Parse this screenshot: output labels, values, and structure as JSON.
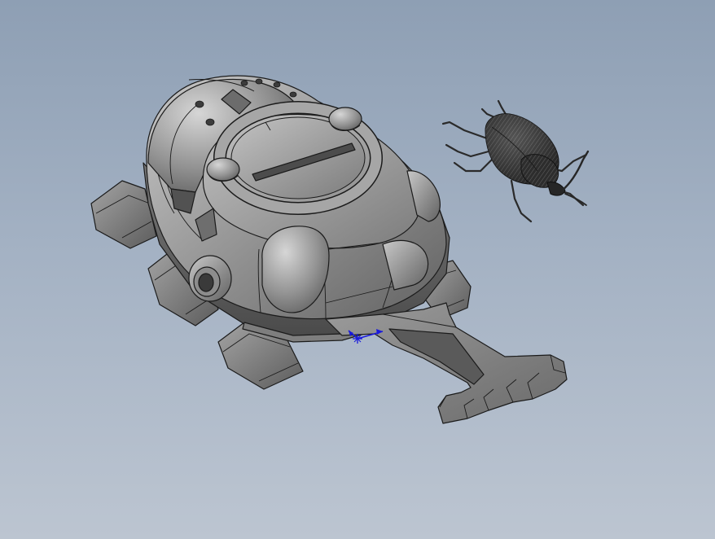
{
  "viewport": {
    "background_top": "#8e9fb4",
    "background_bottom": "#bcc5d1"
  },
  "model": {
    "body_color": "#8a8a8a",
    "shade_color": "#5e5e5e",
    "highlight_color": "#b8b8b8",
    "edge_color": "#1b1b1b"
  },
  "beetle": {
    "color": "#2a2a2a"
  },
  "triad": {
    "icon": "coordinate-triad-icon",
    "color": "#1a1adc"
  }
}
